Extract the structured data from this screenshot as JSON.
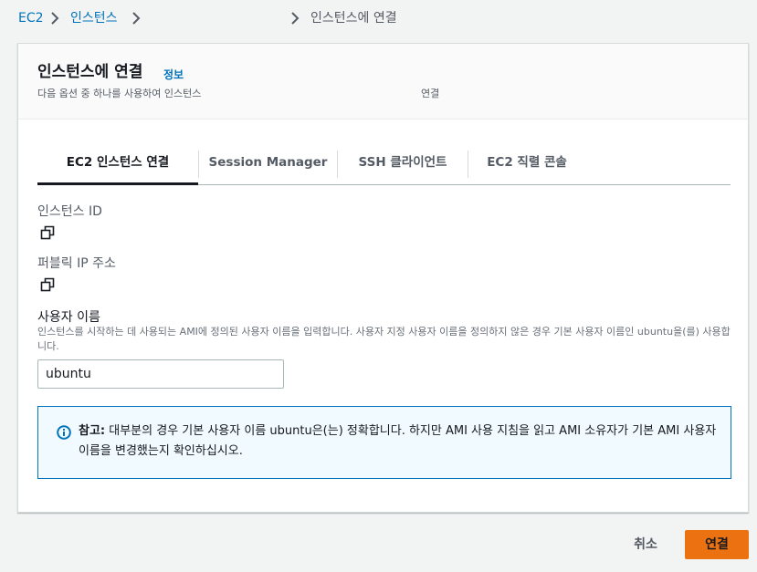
{
  "breadcrumb": {
    "items": [
      "EC2",
      "인스턴스",
      "인스턴스에 연결"
    ]
  },
  "panel": {
    "title": "인스턴스에 연결",
    "info_link": "정보",
    "description_start": "다음 옵션 중 하나를 사용하여 인스턴스",
    "description_end": "연결"
  },
  "tabs": [
    {
      "label": "EC2 인스턴스 연결",
      "active": true
    },
    {
      "label": "Session Manager",
      "active": false
    },
    {
      "label": "SSH 클라이언트",
      "active": false
    },
    {
      "label": "EC2 직렬 콘솔",
      "active": false
    }
  ],
  "fields": {
    "instance_id_label": "인스턴스 ID",
    "public_ip_label": "퍼블릭 IP 주소",
    "username_label": "사용자 이름",
    "username_description": "인스턴스를 시작하는 데 사용되는 AMI에 정의된 사용자 이름을 입력합니다. 사용자 지정 사용자 이름을 정의하지 않은 경우 기본 사용자 이름인 ubuntu을(를) 사용합니다.",
    "username_value": "ubuntu"
  },
  "alert": {
    "title": "참고:",
    "message": "대부분의 경우 기본 사용자 이름 ubuntu은(는) 정확합니다. 하지만 AMI 사용 지침을 읽고 AMI 소유자가 기본 AMI 사용자 이름을 변경했는지 확인하십시오."
  },
  "footer": {
    "cancel_label": "취소",
    "connect_label": "연결"
  },
  "colors": {
    "link": "#0073bb",
    "primary_button": "#ec7211",
    "alert_border": "#0073bb",
    "alert_background": "#f1faff"
  },
  "icons": [
    "chevron-right-icon",
    "copy-icon",
    "info-circle-icon"
  ]
}
